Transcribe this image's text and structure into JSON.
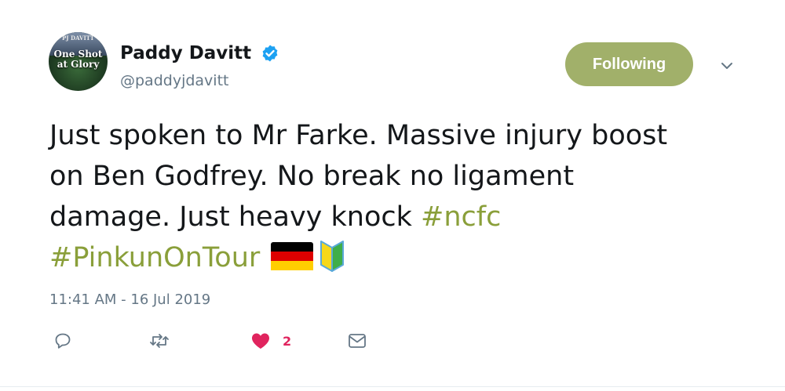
{
  "author": {
    "name": "Paddy Davitt",
    "handle": "@paddyjdavitt",
    "verified": true,
    "avatar_text_top": "PJ DAVITT",
    "avatar_text_line1": "One Shot",
    "avatar_text_line2": "at Glory"
  },
  "follow_button": {
    "label": "Following"
  },
  "tweet": {
    "line1": "Just spoken to Mr Farke. Massive injury boost",
    "line2": "on Ben Godfrey. No break no ligament",
    "line3_text": "damage. Just heavy knock ",
    "hashtag1": "#ncfc",
    "hashtag2": "#PinkunOnTour",
    "emojis": [
      "flag-germany",
      "japanese-beginner-symbol"
    ]
  },
  "timestamp": "11:41 AM - 16 Jul 2019",
  "actions": {
    "reply_icon": "reply-icon",
    "retweet_icon": "retweet-icon",
    "like_icon": "heart-icon",
    "like_count": "2",
    "dm_icon": "envelope-icon"
  },
  "colors": {
    "accent": "#a1b06a",
    "hashtag": "#8a9f3a",
    "verified": "#1da1f2",
    "like": "#e0245e",
    "secondary_text": "#657786"
  }
}
